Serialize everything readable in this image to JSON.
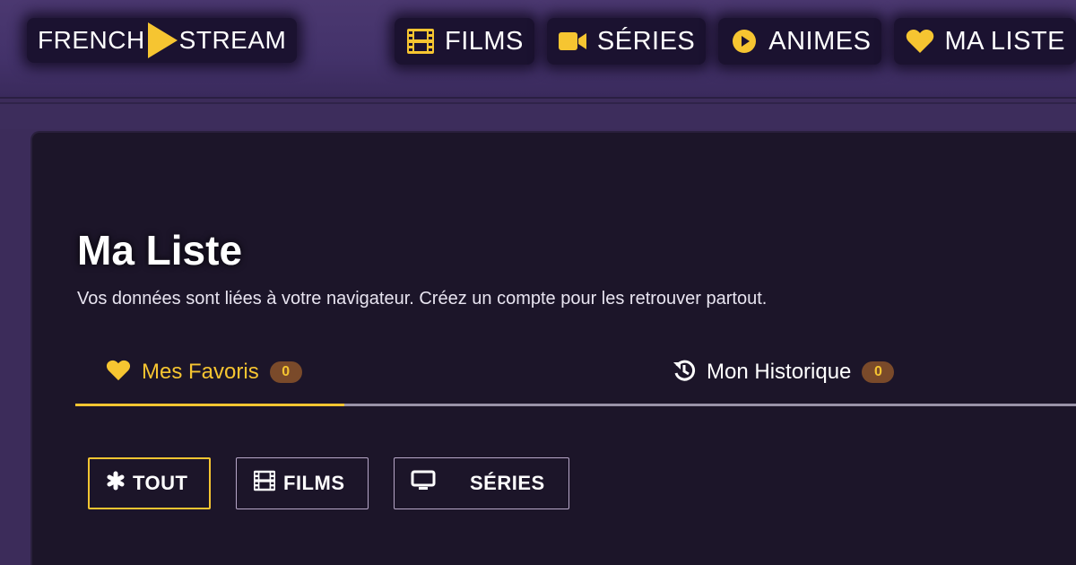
{
  "colors": {
    "accent": "#f6c531",
    "background": "#3c2c5a",
    "panel": "#1c1529",
    "badge": "#7a4a2a"
  },
  "header": {
    "logo": {
      "left": "FRENCH",
      "right": "STREAM",
      "icon": "play-triangle-icon"
    },
    "nav": [
      {
        "label": "FILMS",
        "icon": "film-icon"
      },
      {
        "label": "SÉRIES",
        "icon": "video-camera-icon"
      },
      {
        "label": "ANIMES",
        "icon": "play-circle-icon"
      },
      {
        "label": "MA LISTE",
        "icon": "heart-icon"
      }
    ]
  },
  "main": {
    "title": "Ma Liste",
    "subtitle": "Vos données sont liées à votre navigateur. Créez un compte pour les retrouver partout.",
    "tabs": [
      {
        "label": "Mes Favoris",
        "count": "0",
        "icon": "heart-icon",
        "active": true
      },
      {
        "label": "Mon Historique",
        "count": "0",
        "icon": "history-icon",
        "active": false
      }
    ],
    "filters": [
      {
        "label": "TOUT",
        "icon": "asterisk-icon",
        "active": true
      },
      {
        "label": "FILMS",
        "icon": "film-icon",
        "active": false
      },
      {
        "label": "SÉRIES",
        "icon": "tv-icon",
        "active": false
      }
    ]
  }
}
